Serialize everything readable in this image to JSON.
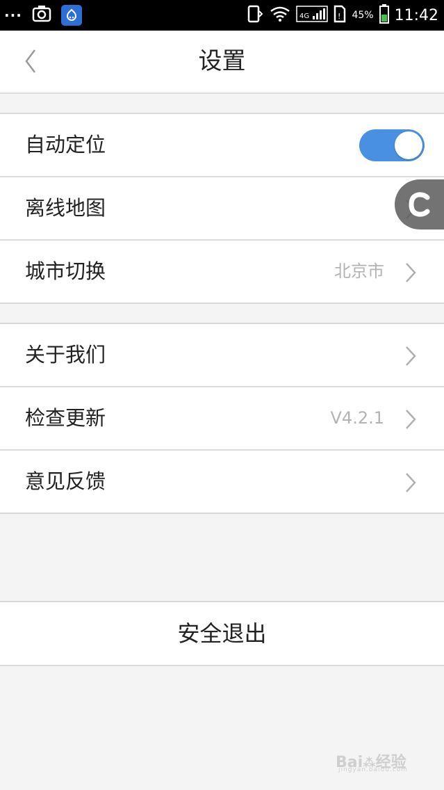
{
  "status_bar": {
    "dots": "···",
    "battery_percent": "45%",
    "time": "11:42",
    "network": "4G",
    "icons": [
      "camera-icon",
      "app-badge-icon",
      "sim-icon",
      "wifi-icon",
      "signal-icon",
      "battery-icon"
    ]
  },
  "header": {
    "title": "设置",
    "back_icon": "chevron-left-icon"
  },
  "group1": {
    "items": [
      {
        "label": "自动定位",
        "control": "toggle",
        "toggle_on": true
      },
      {
        "label": "离线地图",
        "value": "",
        "control": "chevron"
      },
      {
        "label": "城市切换",
        "value": "北京市",
        "control": "chevron"
      }
    ]
  },
  "group2": {
    "items": [
      {
        "label": "关于我们",
        "value": "",
        "control": "chevron"
      },
      {
        "label": "检查更新",
        "value": "V4.2.1",
        "control": "chevron"
      },
      {
        "label": "意见反馈",
        "value": "",
        "control": "chevron"
      }
    ]
  },
  "logout": {
    "label": "安全退出"
  },
  "colors": {
    "accent": "#4a90e2",
    "background": "#f4f4f4",
    "text": "#222222",
    "secondary_text": "#b3b3b3"
  }
}
